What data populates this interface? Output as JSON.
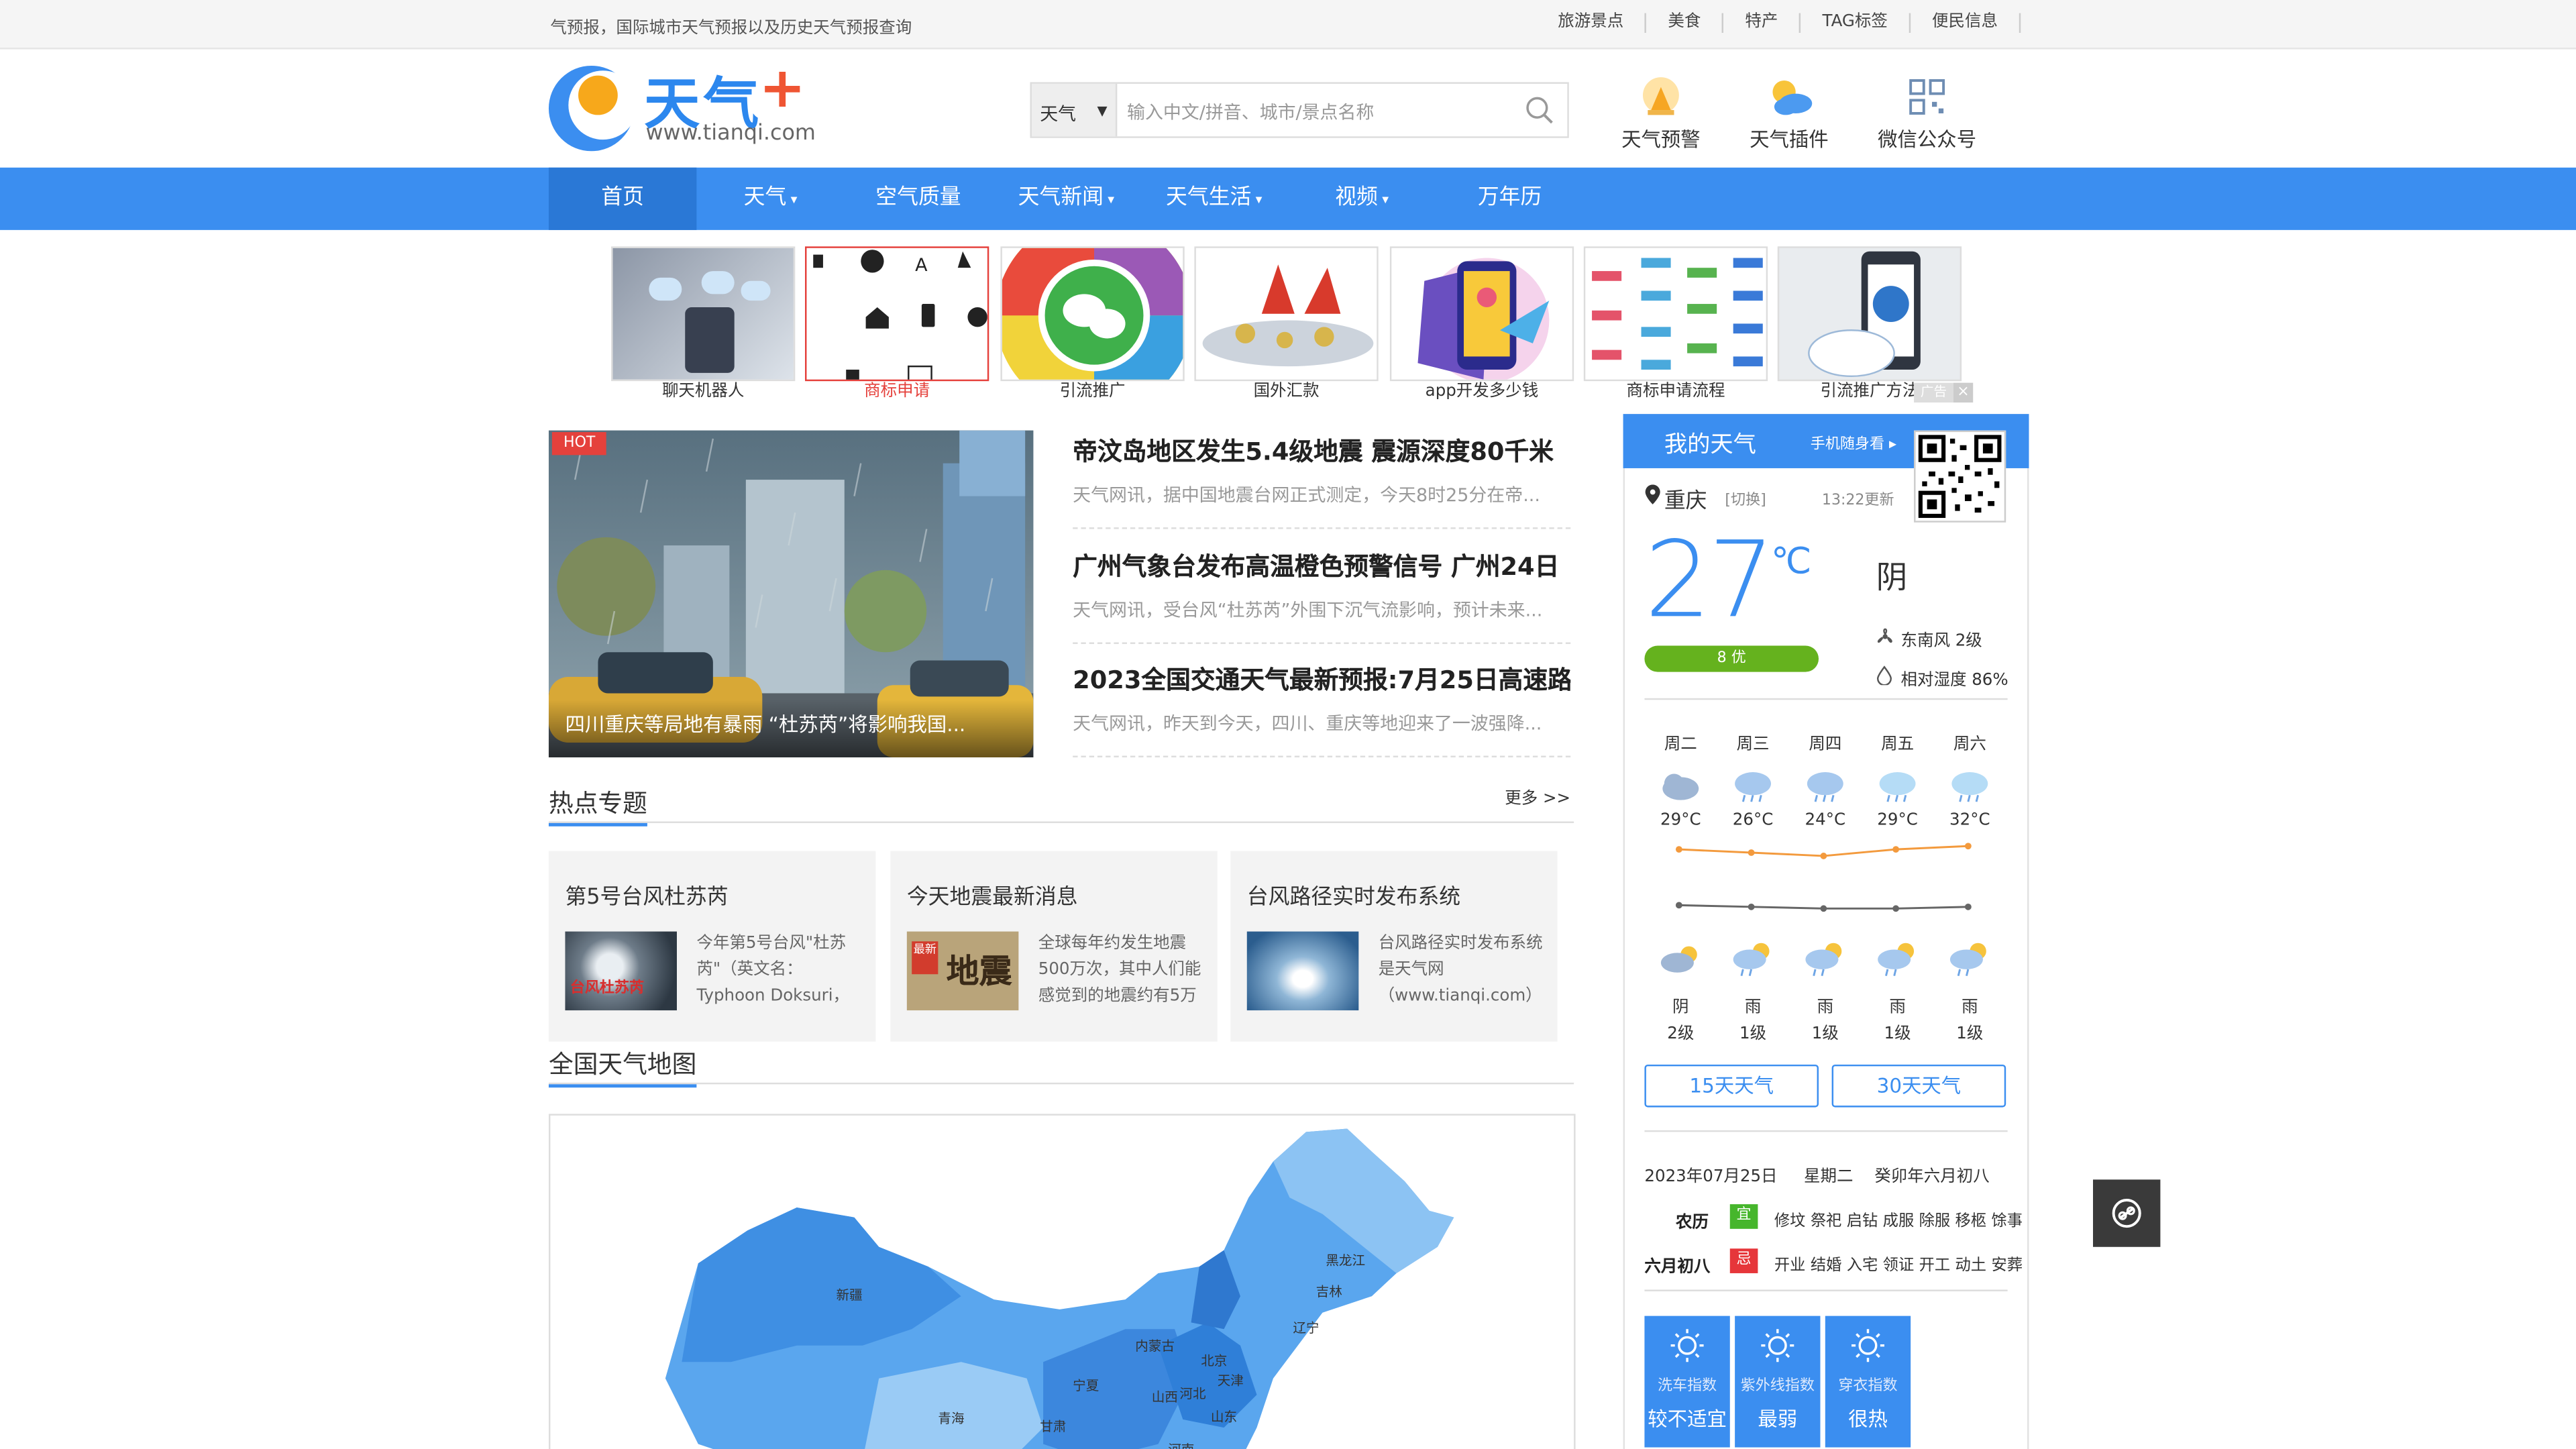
{
  "topbar": {
    "tagline": "气预报，国际城市天气预报以及历史天气预报查询",
    "links": [
      "旅游景点",
      "美食",
      "特产",
      "TAG标签",
      "便民信息"
    ]
  },
  "header": {
    "logo_text": "天气",
    "logo_plus": "+",
    "logo_url": "www.tianqi.com",
    "search": {
      "select_value": "天气",
      "placeholder": "输入中文/拼音、城市/景点名称"
    },
    "icons": [
      {
        "label": "天气预警",
        "icon": "warning-icon"
      },
      {
        "label": "天气插件",
        "icon": "sun-cloud-icon"
      },
      {
        "label": "微信公众号",
        "icon": "qrcode-icon"
      }
    ]
  },
  "nav": {
    "items": [
      "首页",
      "天气",
      "空气质量",
      "天气新闻",
      "天气生活",
      "视频",
      "万年历"
    ]
  },
  "ads": {
    "items": [
      "聊天机器人",
      "商标申请",
      "引流推广",
      "国外汇款",
      "app开发多少钱",
      "商标申请流程",
      "引流推广方法"
    ],
    "tag": "广告",
    "close": "×"
  },
  "hot": {
    "badge": "HOT",
    "caption": "四川重庆等局地有暴雨 “杜苏芮”将影响我国..."
  },
  "news": [
    {
      "title": "帝汶岛地区发生5.4级地震 震源深度80千米",
      "summary": "天气网讯，据中国地震台网正式测定，今天8时25分在帝..."
    },
    {
      "title": "广州气象台发布高温橙色预警信号 广州24日",
      "summary": "天气网讯，受台风“杜苏芮”外围下沉气流影响，预计未来..."
    },
    {
      "title": "2023全国交通天气最新预报:7月25日高速路",
      "summary": "天气网讯，昨天到今天，四川、重庆等地迎来了一波强降..."
    }
  ],
  "topics": {
    "title": "热点专题",
    "more": "更多 >>",
    "items": [
      {
        "title": "第5号台风杜苏芮",
        "desc": "今年第5号台风\"杜苏芮\"（英文名：Typhoon Doksuri，"
      },
      {
        "title": "今天地震最新消息",
        "desc": "全球每年约发生地震500万次，其中人们能感觉到的地震约有5万"
      },
      {
        "title": "台风路径实时发布系统",
        "desc": "台风路径实时发布系统是天气网（www.tianqi.com）"
      }
    ],
    "img_labels": [
      "台风杜苏芮",
      "最新",
      "地震"
    ]
  },
  "map": {
    "title": "全国天气地图",
    "regions": [
      "新疆",
      "内蒙古",
      "黑龙江",
      "吉林",
      "辽宁",
      "北京",
      "天津",
      "河北",
      "山西",
      "山东",
      "宁夏",
      "青海",
      "甘肃",
      "河南"
    ]
  },
  "weather": {
    "title": "我的天气",
    "mobile": "手机随身看",
    "city": "重庆",
    "switch": "[切换]",
    "updated": "13:22更新",
    "temp": "27",
    "unit": "℃",
    "condition": "阴",
    "aqi": "8 优",
    "wind": "东南风 2级",
    "humidity": "相对湿度 86%",
    "forecast": [
      {
        "day": "周二",
        "high": "29°C",
        "cond": "阴",
        "wind": "2级"
      },
      {
        "day": "周三",
        "high": "26°C",
        "cond": "雨",
        "wind": "1级"
      },
      {
        "day": "周四",
        "high": "24°C",
        "cond": "雨",
        "wind": "1级"
      },
      {
        "day": "周五",
        "high": "29°C",
        "cond": "雨",
        "wind": "1级"
      },
      {
        "day": "周六",
        "high": "32°C",
        "cond": "雨",
        "wind": "1级"
      }
    ],
    "btn15": "15天天气",
    "btn30": "30天天气",
    "date": "2023年07月25日",
    "weekday": "星期二",
    "lunar_full": "癸卯年六月初八",
    "lunar_label": "农历",
    "lunar_day": "六月初八",
    "yi_label": "宜",
    "ji_label": "忌",
    "yi": "修坟 祭祀 启钻 成服 除服 移柩 馀事",
    "ji": "开业 结婚 入宅 领证 开工 动土 安葬",
    "indices": [
      {
        "name": "洗车指数",
        "value": "较不适宜"
      },
      {
        "name": "紫外线指数",
        "value": "最弱"
      },
      {
        "name": "穿衣指数",
        "value": "很热"
      }
    ]
  },
  "colors": {
    "brand": "#3b8ef0",
    "nav_active": "#2a78d6",
    "hot": "#e5413c",
    "aqi": "#65b21e",
    "yi": "#46b62c",
    "ji": "#e6363a",
    "trend_high": "#f39a3d",
    "trend_low": "#666666"
  }
}
